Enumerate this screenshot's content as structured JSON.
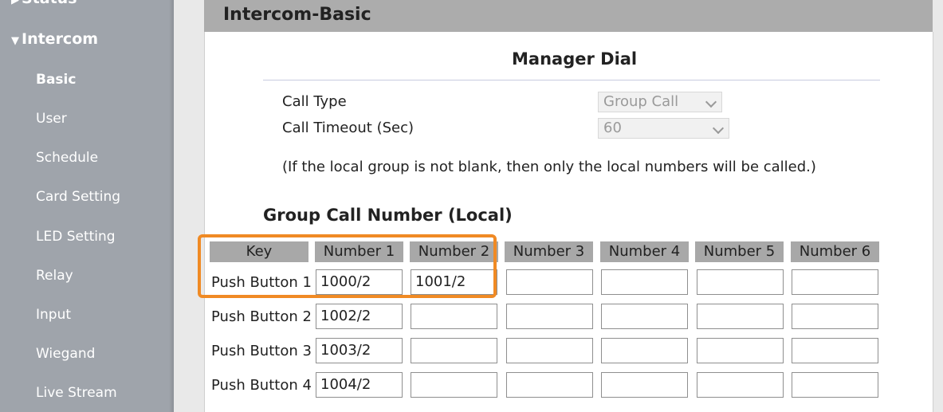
{
  "sidebar": {
    "status_label": "Status",
    "intercom_label": "Intercom",
    "items": [
      {
        "label": "Basic"
      },
      {
        "label": "User"
      },
      {
        "label": "Schedule"
      },
      {
        "label": "Card Setting"
      },
      {
        "label": "LED Setting"
      },
      {
        "label": "Relay"
      },
      {
        "label": "Input"
      },
      {
        "label": "Wiegand"
      },
      {
        "label": "Live Stream"
      }
    ]
  },
  "header": {
    "title": "Intercom-Basic"
  },
  "manager_dial": {
    "title": "Manager Dial",
    "call_type": {
      "label": "Call Type",
      "value": "Group Call"
    },
    "call_timeout": {
      "label": "Call Timeout (Sec)",
      "value": "60"
    },
    "note": "(If the local group is not blank, then only the local numbers will be called.)"
  },
  "group_call": {
    "title": "Group Call Number (Local)",
    "columns": [
      "Key",
      "Number 1",
      "Number 2",
      "Number 3",
      "Number 4",
      "Number 5",
      "Number 6"
    ],
    "rows": [
      {
        "key": "Push Button 1",
        "values": [
          "1000/2",
          "1001/2",
          "",
          "",
          "",
          ""
        ]
      },
      {
        "key": "Push Button 2",
        "values": [
          "1002/2",
          "",
          "",
          "",
          "",
          ""
        ]
      },
      {
        "key": "Push Button 3",
        "values": [
          "1003/2",
          "",
          "",
          "",
          "",
          ""
        ]
      },
      {
        "key": "Push Button 4",
        "values": [
          "1004/2",
          "",
          "",
          "",
          "",
          ""
        ]
      }
    ]
  },
  "colors": {
    "sidebar": "#9fa4ab",
    "highlight": "#f08a24",
    "column_header": "#a8a8a8"
  }
}
